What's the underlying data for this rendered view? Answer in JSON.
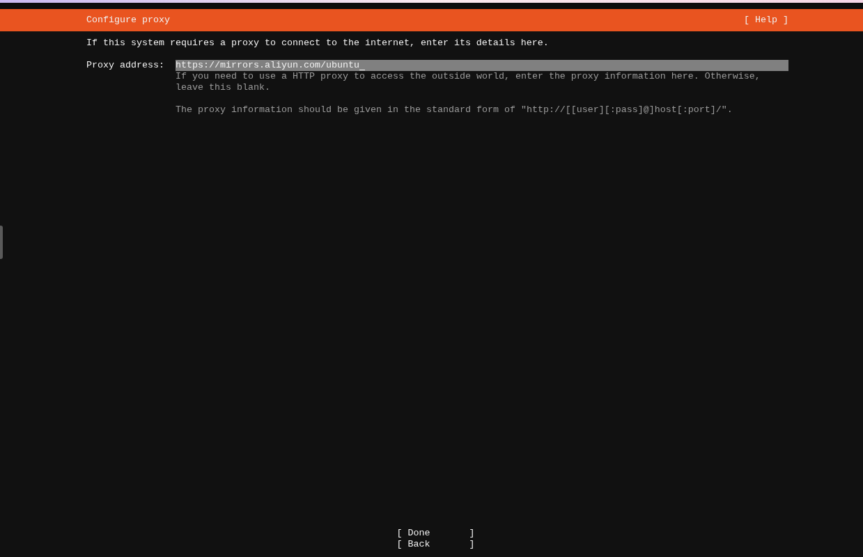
{
  "header": {
    "title": "Configure proxy",
    "help": "[ Help ]"
  },
  "intro": "If this system requires a proxy to connect to the internet, enter its details here.",
  "proxy_field": {
    "label": "Proxy address:",
    "value": "https://mirrors.aliyun.com/ubuntu",
    "focused": true,
    "help": [
      "If you need to use a HTTP proxy to access the outside world, enter the proxy information here. Otherwise, leave this blank.",
      "The proxy information should be given in the standard form of \"http://[[user][:pass]@]host[:port]/\"."
    ]
  },
  "buttons": [
    {
      "label": "[ Done       ]"
    },
    {
      "label": "[ Back       ]"
    }
  ]
}
